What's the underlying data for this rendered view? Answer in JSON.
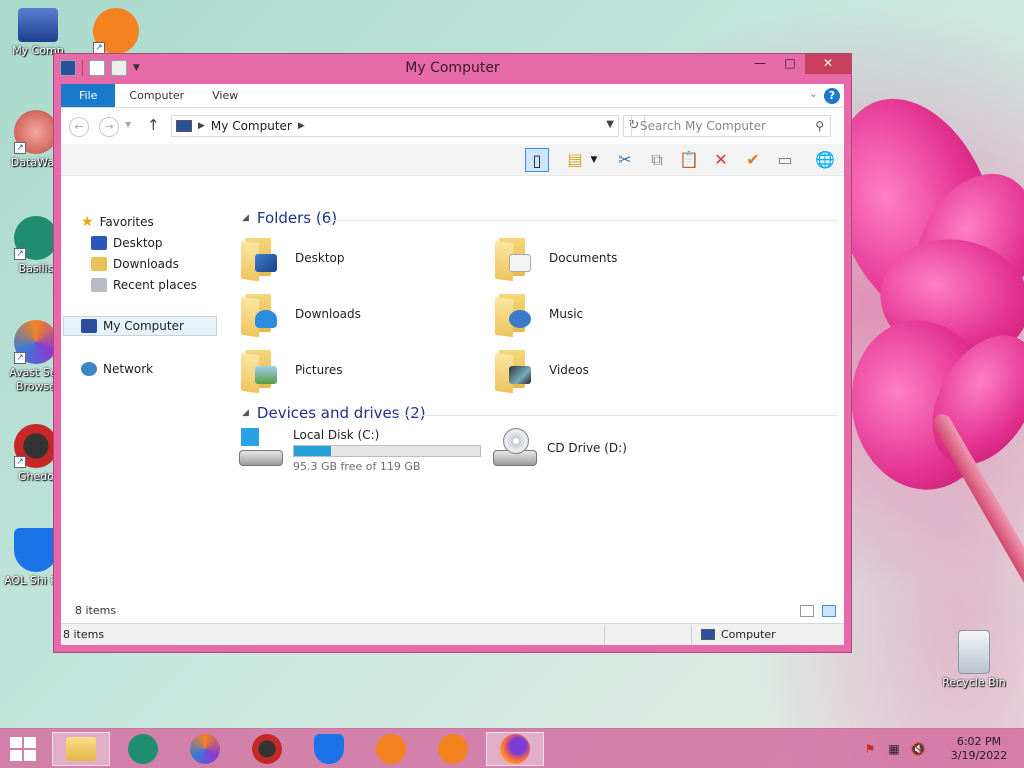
{
  "desktop": {
    "icons": [
      {
        "label": "My Comp"
      },
      {
        "label": ""
      },
      {
        "label": "DataWag"
      },
      {
        "label": "Basilis"
      },
      {
        "label": "Avast Sec Browse"
      },
      {
        "label": "Ghedo"
      },
      {
        "label": "AOL Shi Pro"
      },
      {
        "label": "Recycle Bin"
      }
    ]
  },
  "window": {
    "title": "My Computer",
    "controls": {
      "minimize": "—",
      "maximize": "□",
      "close": "✕"
    },
    "ribbon_tabs": [
      "File",
      "Computer",
      "View"
    ],
    "help": "?",
    "address": {
      "location": "My Computer"
    },
    "search": {
      "placeholder": "Search My Computer"
    },
    "nav": {
      "favorites": "Favorites",
      "desktop": "Desktop",
      "downloads": "Downloads",
      "recent": "Recent places",
      "computer": "My Computer",
      "network": "Network"
    },
    "folders_header": "Folders (6)",
    "folders": [
      "Desktop",
      "Documents",
      "Downloads",
      "Music",
      "Pictures",
      "Videos"
    ],
    "devices_header": "Devices and drives (2)",
    "drives": [
      {
        "name": "Local Disk (C:)",
        "free": "95.3 GB free of 119 GB",
        "used_fraction": 0.2
      },
      {
        "name": "CD Drive (D:)"
      }
    ],
    "item_count": "8 items",
    "status": {
      "count": "8 items",
      "location": "Computer"
    }
  },
  "taskbar": {
    "clock_time": "6:02 PM",
    "clock_date": "3/19/2022"
  },
  "colors": {
    "window_frame": "#e76aa8",
    "accent": "#1979ca",
    "progress": "#26a0da"
  }
}
